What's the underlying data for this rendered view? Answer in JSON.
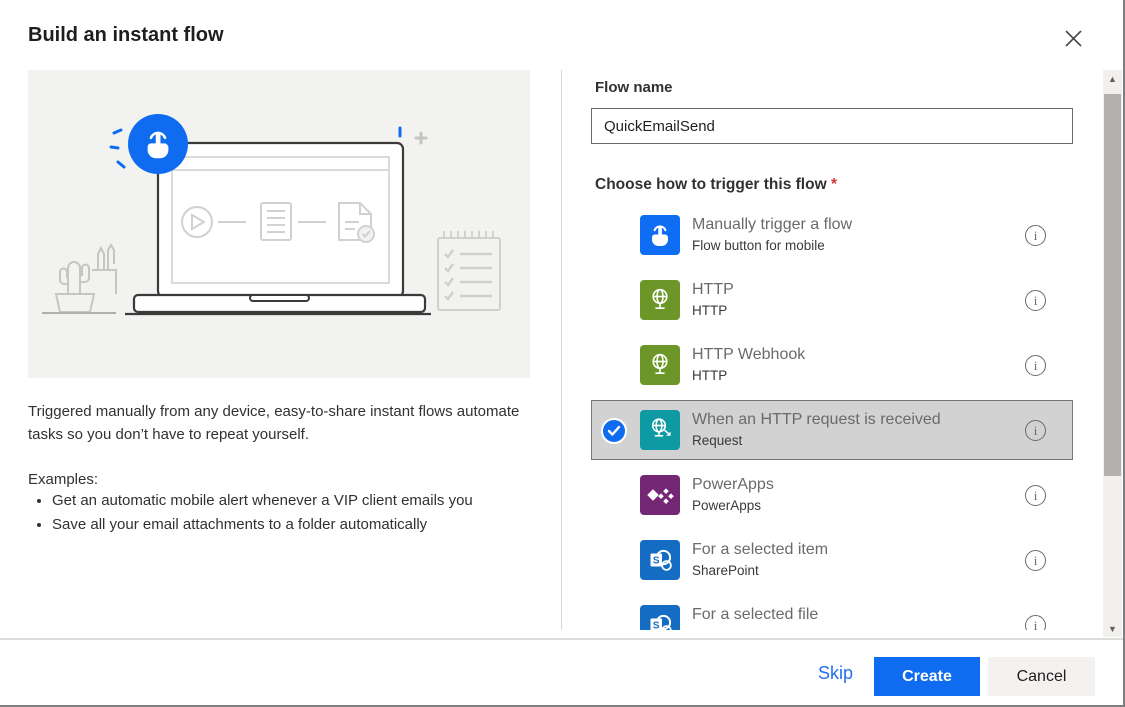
{
  "dialog": {
    "title": "Build an instant flow"
  },
  "left": {
    "description": "Triggered manually from any device, easy-to-share instant flows automate tasks so you don’t have to repeat yourself.",
    "examples_label": "Examples:",
    "examples": [
      "Get an automatic mobile alert whenever a VIP client emails you",
      "Save all your email attachments to a folder automatically"
    ]
  },
  "form": {
    "flow_name_label": "Flow name",
    "flow_name_value": "QuickEmailSend",
    "trigger_label": "Choose how to trigger this flow",
    "required_marker": "*"
  },
  "triggers": [
    {
      "title": "Manually trigger a flow",
      "subtitle": "Flow button for mobile",
      "icon": "touch-icon",
      "color": "#0e6df2",
      "selected": false
    },
    {
      "title": "HTTP",
      "subtitle": "HTTP",
      "icon": "globe-icon",
      "color": "#6d9629",
      "selected": false
    },
    {
      "title": "HTTP Webhook",
      "subtitle": "HTTP",
      "icon": "globe-icon",
      "color": "#6d9629",
      "selected": false
    },
    {
      "title": "When an HTTP request is received",
      "subtitle": "Request",
      "icon": "globe-request-icon",
      "color": "#0d9aa2",
      "selected": true
    },
    {
      "title": "PowerApps",
      "subtitle": "PowerApps",
      "icon": "powerapps-icon",
      "color": "#742774",
      "selected": false
    },
    {
      "title": "For a selected item",
      "subtitle": "SharePoint",
      "icon": "sharepoint-icon",
      "color": "#146dc2",
      "selected": false
    },
    {
      "title": "For a selected file",
      "subtitle": "",
      "icon": "sharepoint-icon",
      "color": "#146dc2",
      "selected": false
    }
  ],
  "footer": {
    "skip_label": "Skip",
    "create_label": "Create",
    "cancel_label": "Cancel"
  },
  "colors": {
    "accent_blue": "#0f6cf0",
    "required_red": "#d13438",
    "selected_row_bg": "#d2d2d2",
    "selected_row_border": "#767676"
  }
}
